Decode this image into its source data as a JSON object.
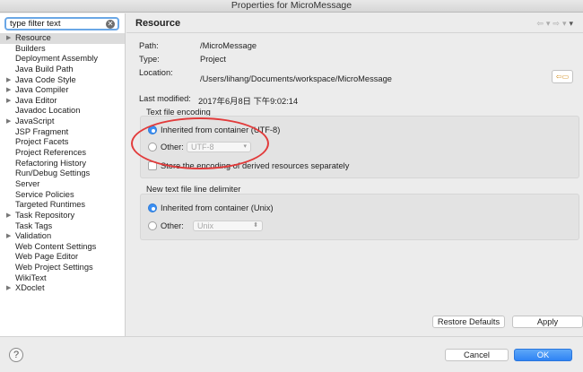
{
  "window": {
    "title": "Properties for MicroMessage"
  },
  "sidebar": {
    "filter_value": "type filter text",
    "items": [
      {
        "label": "Resource",
        "expandable": true,
        "selected": true
      },
      {
        "label": "Builders",
        "expandable": false
      },
      {
        "label": "Deployment Assembly",
        "expandable": false
      },
      {
        "label": "Java Build Path",
        "expandable": false
      },
      {
        "label": "Java Code Style",
        "expandable": true
      },
      {
        "label": "Java Compiler",
        "expandable": true
      },
      {
        "label": "Java Editor",
        "expandable": true
      },
      {
        "label": "Javadoc Location",
        "expandable": false
      },
      {
        "label": "JavaScript",
        "expandable": true
      },
      {
        "label": "JSP Fragment",
        "expandable": false
      },
      {
        "label": "Project Facets",
        "expandable": false
      },
      {
        "label": "Project References",
        "expandable": false
      },
      {
        "label": "Refactoring History",
        "expandable": false
      },
      {
        "label": "Run/Debug Settings",
        "expandable": false
      },
      {
        "label": "Server",
        "expandable": false
      },
      {
        "label": "Service Policies",
        "expandable": false
      },
      {
        "label": "Targeted Runtimes",
        "expandable": false
      },
      {
        "label": "Task Repository",
        "expandable": true
      },
      {
        "label": "Task Tags",
        "expandable": false
      },
      {
        "label": "Validation",
        "expandable": true
      },
      {
        "label": "Web Content Settings",
        "expandable": false
      },
      {
        "label": "Web Page Editor",
        "expandable": false
      },
      {
        "label": "Web Project Settings",
        "expandable": false
      },
      {
        "label": "WikiText",
        "expandable": false
      },
      {
        "label": "XDoclet",
        "expandable": true
      }
    ]
  },
  "page": {
    "title": "Resource",
    "path_label": "Path:",
    "path_value": "/MicroMessage",
    "type_label": "Type:",
    "type_value": "Project",
    "location_label": "Location:",
    "location_value": "/Users/lihang/Documents/workspace/MicroMessage",
    "modified_label": "Last modified:",
    "modified_value": "2017年6月8日 下午9:02:14",
    "encoding": {
      "group_title": "Text file encoding",
      "inherited_label": "Inherited from container (UTF-8)",
      "other_label": "Other:",
      "other_value": "UTF-8",
      "store_label": "Store the encoding of derived resources separately"
    },
    "delimiter": {
      "group_title": "New text file line delimiter",
      "inherited_label": "Inherited from container (Unix)",
      "other_label": "Other:",
      "other_value": "Unix"
    },
    "restore_defaults_label": "Restore Defaults",
    "apply_label": "Apply"
  },
  "footer": {
    "cancel_label": "Cancel",
    "ok_label": "OK"
  },
  "colors": {
    "accent": "#3b8ff3",
    "annotation": "#e23b3b"
  }
}
